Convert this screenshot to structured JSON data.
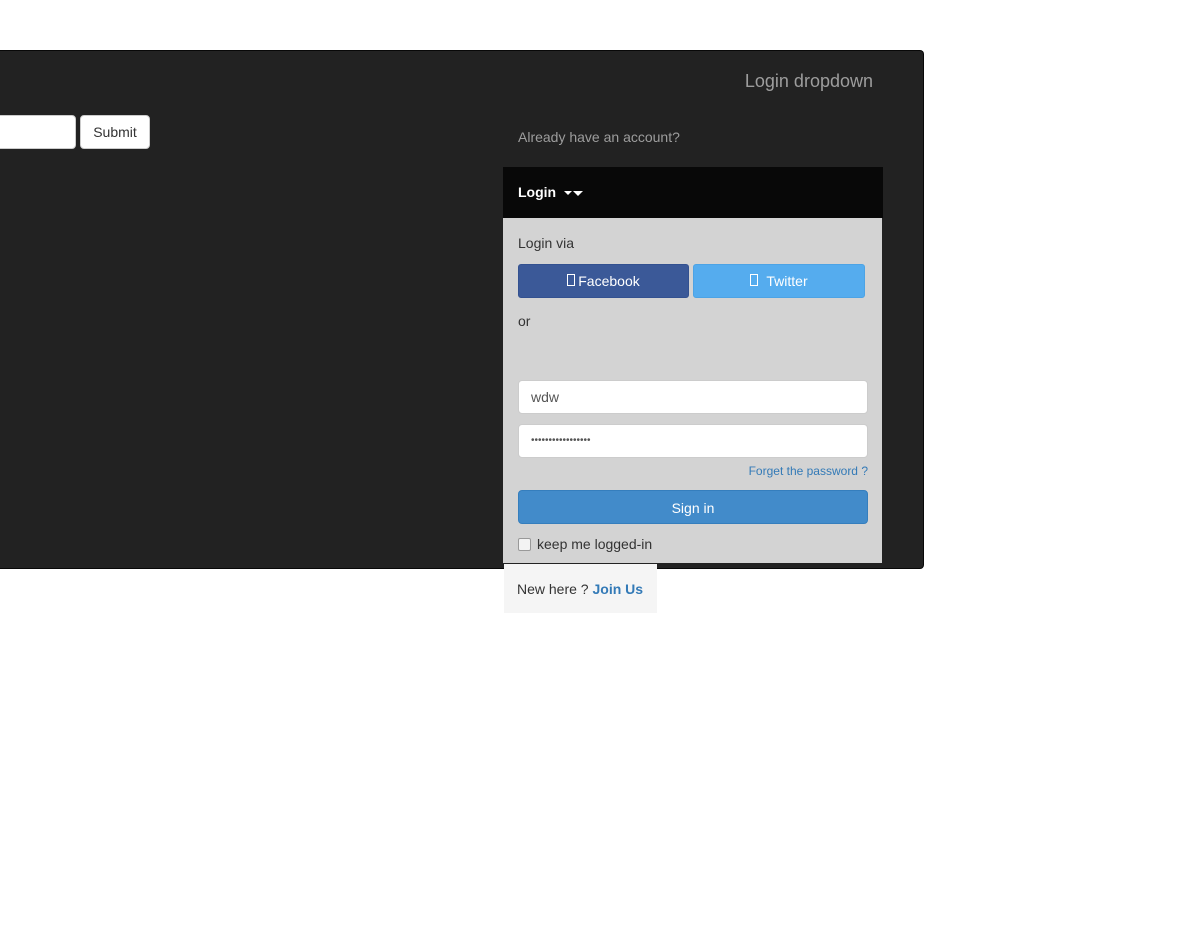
{
  "navbar": {
    "brand": "Login dropdown",
    "search": {
      "value": "",
      "placeholder": ""
    },
    "submit_label": "Submit",
    "already_text": "Already have an account?",
    "login_toggle_label": "Login"
  },
  "dropdown": {
    "login_via": "Login via",
    "facebook_label": "Facebook",
    "twitter_label": "Twitter",
    "or_text": "or",
    "username_value": "wdw",
    "password_value": "•••••••••••••••••",
    "forgot_label": "Forget the password ?",
    "signin_label": "Sign in",
    "keep_label": "keep me logged-in",
    "keep_checked": false,
    "footer_text": "New here ?",
    "join_label": "Join Us"
  },
  "colors": {
    "navbar_bg": "#222222",
    "toggle_bg": "#080808",
    "menu_bg": "#d3d3d3",
    "facebook": "#3b5998",
    "twitter": "#55acee",
    "primary": "#428bca",
    "link": "#337ab7"
  },
  "icons": {
    "facebook": "facebook-icon",
    "twitter": "twitter-icon",
    "caret": "caret-down-icon"
  }
}
